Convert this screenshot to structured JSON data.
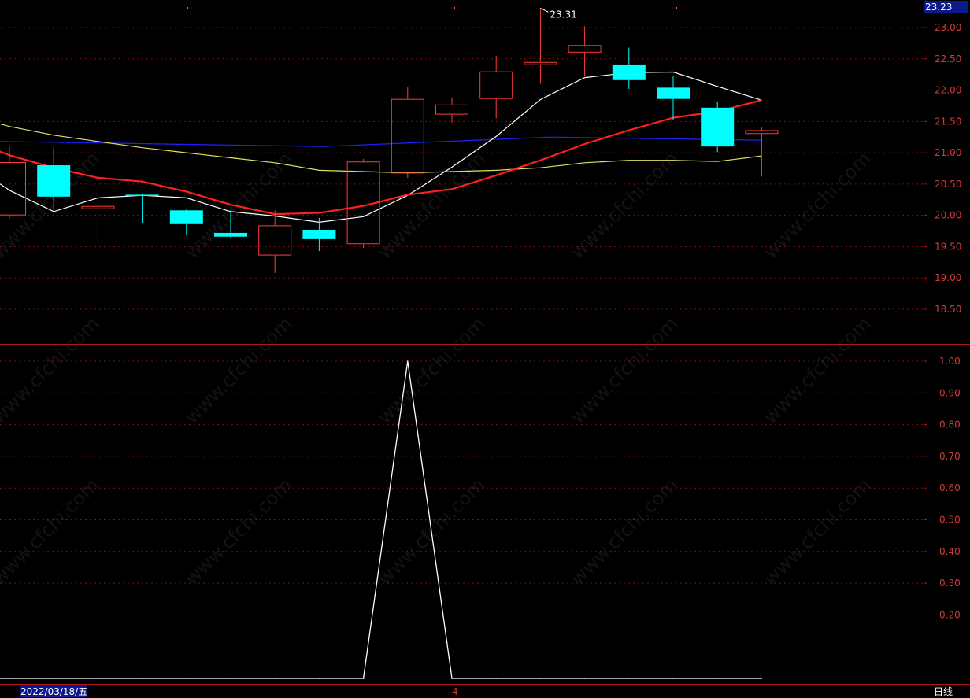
{
  "current_price_label": "23.23",
  "high_annotation": "23.31",
  "date_label": "2022/03/18/五",
  "cursor_label": "4",
  "period_label": "日线",
  "watermark": "www.cfchi.com",
  "colors": {
    "background": "#000000",
    "up": "#ff3c3c",
    "down": "#00ffff",
    "ma5": "#ffffff",
    "ma10": "#ff2020",
    "ma20": "#e0e060",
    "ma60": "#2020ff",
    "grid": "#7a1010",
    "tick_text": "#d23b3b",
    "indicator_line": "#ffffff",
    "cursor_bg": "#0a1a8a"
  },
  "chart_data": [
    {
      "type": "candlestick",
      "name": "price-panel",
      "ylim": [
        18.2,
        23.6
      ],
      "y_ticks": [
        23.0,
        22.5,
        22.0,
        21.5,
        21.0,
        20.5,
        20.0,
        19.5,
        19.0,
        18.5
      ],
      "candles": [
        {
          "open": 20.0,
          "high": 21.1,
          "low": 19.95,
          "close": 20.85
        },
        {
          "open": 20.8,
          "high": 21.08,
          "low": 20.05,
          "close": 20.3
        },
        {
          "open": 20.1,
          "high": 20.45,
          "low": 19.6,
          "close": 20.15
        },
        {
          "open": 20.33,
          "high": 20.35,
          "low": 19.88,
          "close": 20.32
        },
        {
          "open": 20.08,
          "high": 20.1,
          "low": 19.68,
          "close": 19.86
        },
        {
          "open": 19.72,
          "high": 20.08,
          "low": 19.65,
          "close": 19.66
        },
        {
          "open": 19.36,
          "high": 20.08,
          "low": 19.08,
          "close": 19.84
        },
        {
          "open": 19.77,
          "high": 19.96,
          "low": 19.43,
          "close": 19.62
        },
        {
          "open": 19.54,
          "high": 20.9,
          "low": 19.48,
          "close": 20.86
        },
        {
          "open": 20.67,
          "high": 22.05,
          "low": 20.6,
          "close": 21.86
        },
        {
          "open": 21.61,
          "high": 21.88,
          "low": 21.48,
          "close": 21.77
        },
        {
          "open": 21.86,
          "high": 22.55,
          "low": 21.55,
          "close": 22.3
        },
        {
          "open": 22.4,
          "high": 23.31,
          "low": 22.1,
          "close": 22.45
        },
        {
          "open": 22.6,
          "high": 23.02,
          "low": 22.22,
          "close": 22.72
        },
        {
          "open": 22.41,
          "high": 22.68,
          "low": 22.02,
          "close": 22.16
        },
        {
          "open": 22.04,
          "high": 22.22,
          "low": 21.52,
          "close": 21.86
        },
        {
          "open": 21.72,
          "high": 21.82,
          "low": 21.01,
          "close": 21.1
        },
        {
          "open": 21.3,
          "high": 21.4,
          "low": 20.62,
          "close": 21.36
        }
      ],
      "ma5": [
        20.4,
        20.06,
        20.28,
        20.32,
        20.28,
        20.06,
        19.99,
        19.89,
        19.98,
        20.32,
        20.77,
        21.26,
        21.85,
        22.2,
        22.28,
        22.29,
        22.06,
        21.84
      ],
      "ma10": [
        20.96,
        20.76,
        20.6,
        20.54,
        20.38,
        20.17,
        20.02,
        20.04,
        20.15,
        20.33,
        20.42,
        20.64,
        20.88,
        21.14,
        21.36,
        21.56,
        21.66,
        21.84
      ],
      "ma20": [
        21.42,
        21.28,
        21.18,
        21.08,
        21.0,
        20.92,
        20.84,
        20.72,
        20.7,
        20.68,
        20.7,
        20.72,
        20.76,
        20.84,
        20.88,
        20.88,
        20.86,
        20.95
      ],
      "ma60_start": 21.18,
      "ma60_end": 21.2
    },
    {
      "type": "line",
      "name": "indicator-panel",
      "ylim": [
        0.0,
        1.03
      ],
      "y_ticks": [
        1.0,
        0.9,
        0.8,
        0.7,
        0.6,
        0.5,
        0.4,
        0.3,
        0.2
      ],
      "values": [
        0,
        0,
        0,
        0,
        0,
        0,
        0,
        0,
        0,
        1.0,
        0,
        0,
        0,
        0,
        0,
        0,
        0,
        0
      ]
    }
  ]
}
